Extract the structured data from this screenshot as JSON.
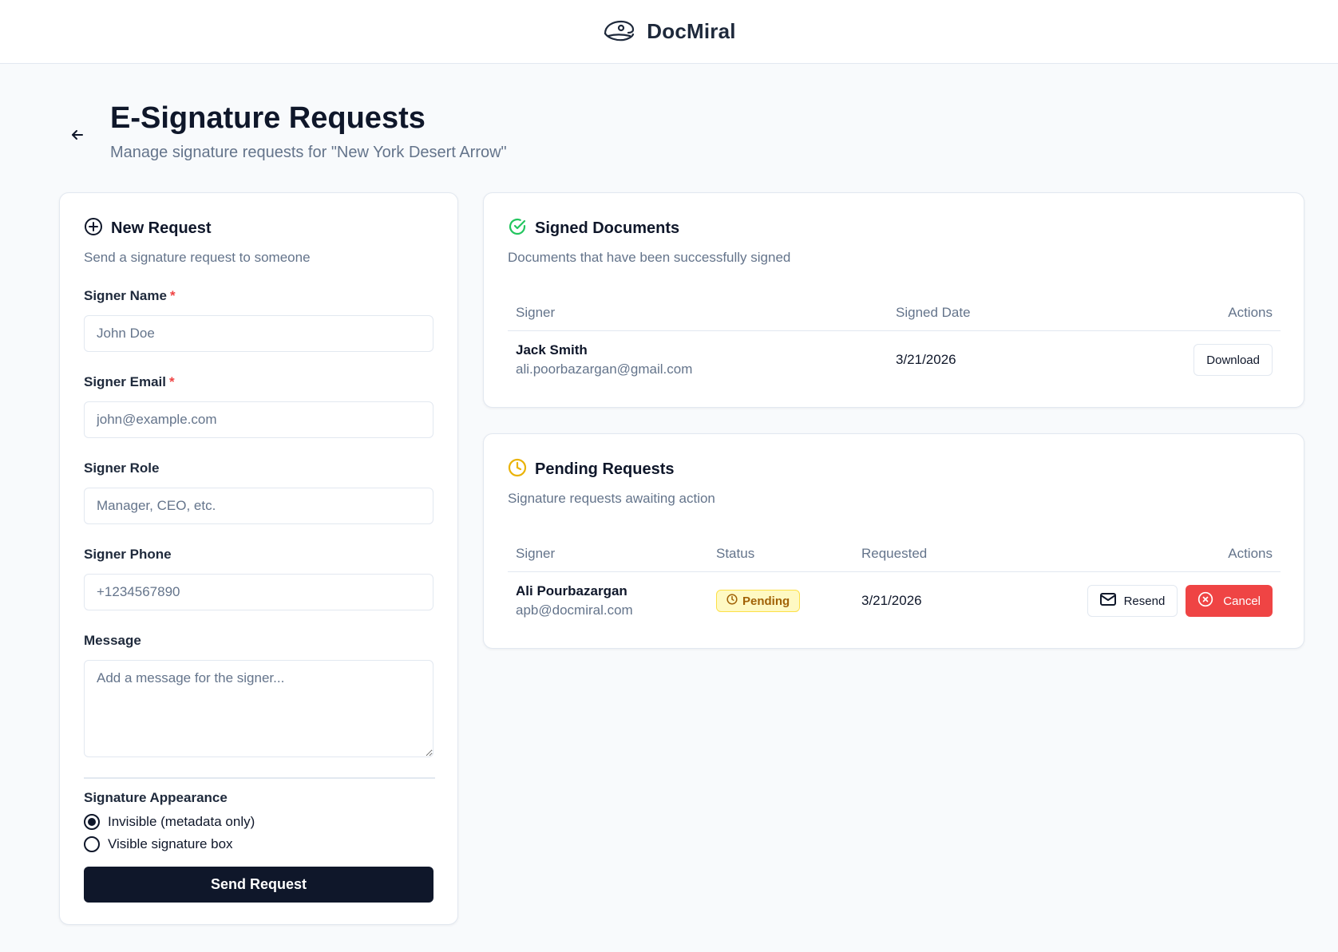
{
  "brand": {
    "name": "DocMiral",
    "logo_icon": "pilot-cap-icon"
  },
  "header": {
    "title": "E-Signature Requests",
    "subtitle": "Manage signature requests for \"New York Desert Arrow\""
  },
  "new_request": {
    "title": "New Request",
    "description": "Send a signature request to someone",
    "fields": {
      "signer_name": {
        "label": "Signer Name",
        "required": "*",
        "placeholder": "John Doe",
        "value": ""
      },
      "signer_email": {
        "label": "Signer Email",
        "required": "*",
        "placeholder": "john@example.com",
        "value": ""
      },
      "signer_role": {
        "label": "Signer Role",
        "placeholder": "Manager, CEO, etc.",
        "value": ""
      },
      "signer_phone": {
        "label": "Signer Phone",
        "placeholder": "+1234567890",
        "value": ""
      },
      "message": {
        "label": "Message",
        "placeholder": "Add a message for the signer...",
        "value": ""
      }
    },
    "appearance": {
      "label": "Signature Appearance",
      "options": [
        {
          "label": "Invisible (metadata only)",
          "selected": true
        },
        {
          "label": "Visible signature box",
          "selected": false
        }
      ]
    },
    "submit_label": "Send Request"
  },
  "signed": {
    "title": "Signed Documents",
    "description": "Documents that have been successfully signed",
    "columns": {
      "signer": "Signer",
      "date": "Signed Date",
      "actions": "Actions"
    },
    "rows": [
      {
        "name": "Jack Smith",
        "email": "ali.poorbazargan@gmail.com",
        "date": "3/21/2026",
        "action": "Download"
      }
    ]
  },
  "pending": {
    "title": "Pending Requests",
    "description": "Signature requests awaiting action",
    "columns": {
      "signer": "Signer",
      "status": "Status",
      "requested": "Requested",
      "actions": "Actions"
    },
    "rows": [
      {
        "name": "Ali Pourbazargan",
        "email": "apb@docmiral.com",
        "status": "Pending",
        "requested": "3/21/2026",
        "resend": "Resend",
        "cancel": "Cancel"
      }
    ]
  },
  "colors": {
    "primary": "#0f172a",
    "success": "#22c55e",
    "warning": "#eab308",
    "danger": "#ef4444",
    "muted": "#64748b"
  }
}
